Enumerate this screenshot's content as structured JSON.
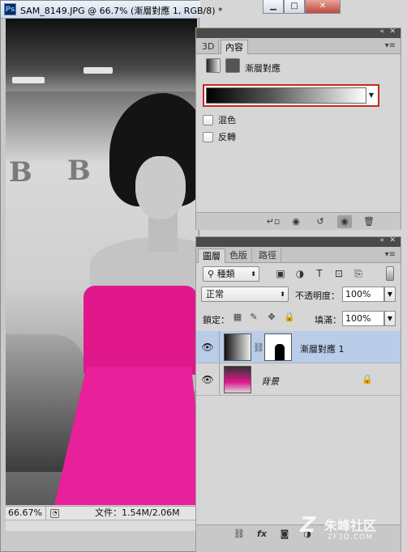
{
  "document": {
    "app_icon": "Ps",
    "title": "SAM_8149.JPG @ 66.7% (漸層對應 1, RGB/8) *",
    "window_buttons": [
      "minimize",
      "maximize",
      "close"
    ],
    "zoom": "66.67%",
    "file_info": "文件：1.54M/2.06M",
    "canvas_text": "B"
  },
  "properties_panel": {
    "tabs": [
      "3D",
      "內容"
    ],
    "active_tab": "內容",
    "title": "漸層對應",
    "gradient": {
      "start_color": "#000000",
      "end_color": "#ffffff"
    },
    "options": [
      {
        "label": "混色",
        "checked": false
      },
      {
        "label": "反轉",
        "checked": false
      }
    ],
    "footer_icons": [
      "clip-to-layer-icon",
      "view-previous-icon",
      "reset-icon",
      "visibility-icon",
      "trash-icon"
    ]
  },
  "layers_panel": {
    "tabs": [
      "圖層",
      "色版",
      "路徑"
    ],
    "active_tab": "圖層",
    "filter": {
      "kind_label": "種類",
      "search_icon": "search-icon"
    },
    "filter_icons": [
      "image-filter-icon",
      "adjustment-filter-icon",
      "type-filter-icon",
      "shape-filter-icon",
      "smart-object-filter-icon"
    ],
    "blend_mode": "正常",
    "opacity_label": "不透明度：",
    "opacity_value": "100%",
    "lock_label": "鎖定：",
    "fill_label": "填滿：",
    "fill_value": "100%",
    "layers": [
      {
        "name": "漸層對應 1",
        "type": "adjustment",
        "visible": true,
        "selected": true
      },
      {
        "name": "背景",
        "type": "image",
        "visible": true,
        "selected": false,
        "locked": true
      }
    ],
    "footer_icons": [
      "link-icon",
      "fx-icon",
      "mask-icon",
      "adjustment-icon",
      "folder-icon",
      "new-layer-icon",
      "trash-icon"
    ],
    "footer_fx_label": "fx"
  },
  "watermark": {
    "logo": "Z",
    "text": "朱峰社区",
    "sub": "ZF3D.COM"
  },
  "colors": {
    "accent_red": "#c42a20",
    "selected_row": "#b9cde9",
    "dress_pink": "#e0188c"
  }
}
